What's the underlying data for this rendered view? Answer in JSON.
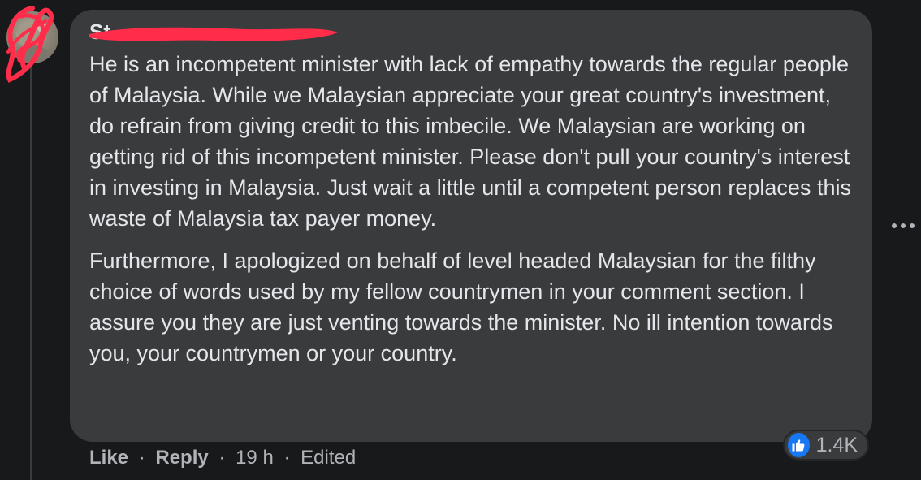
{
  "comment": {
    "author_name": "St",
    "paragraphs": [
      "He is an incompetent minister with lack of empathy towards the regular people of Malaysia. While we Malaysian appreciate your great country's investment, do refrain from giving credit to this imbecile. We Malaysian are working on getting rid of this incompetent minister. Please don't pull your country's interest in investing in Malaysia. Just wait a little until a competent person replaces this waste of Malaysia tax payer money.",
      "Furthermore, I apologized on behalf of level headed Malaysian for the filthy choice of words used by my fellow countrymen in your comment section. I assure you they are just venting towards the minister. No ill intention towards you, your countrymen or your country."
    ]
  },
  "actions": {
    "like_label": "Like",
    "reply_label": "Reply",
    "separator": "·",
    "timestamp": "19 h",
    "edited_label": "Edited"
  },
  "reactions": {
    "count": "1.4K",
    "icon": "thumbs-up-icon",
    "color": "#1877f2"
  },
  "more_menu": {
    "icon": "more-options-icon",
    "glyph": "•••"
  },
  "colors": {
    "background": "#18191a",
    "bubble": "#3a3b3c",
    "text": "#e4e6eb",
    "secondary_text": "#b0b3b8",
    "redaction": "#ff2d4a"
  }
}
